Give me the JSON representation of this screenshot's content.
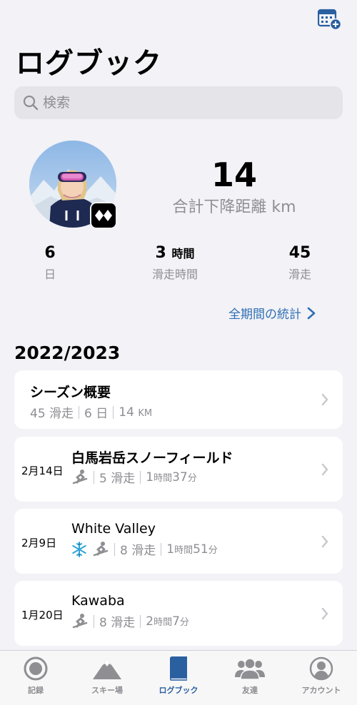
{
  "header": {
    "title": "ログブック"
  },
  "search": {
    "placeholder": "検索"
  },
  "summary": {
    "total_descent_value": "14",
    "total_descent_label": "合計下降距離 km",
    "stats": [
      {
        "value": "6",
        "unit": "",
        "label": "日"
      },
      {
        "value": "3",
        "unit": "時間",
        "label": "滑走時間"
      },
      {
        "value": "45",
        "unit": "",
        "label": "滑走"
      }
    ],
    "all_stats_link": "全期間の統計"
  },
  "season": {
    "title": "2022/2023",
    "overview": {
      "title": "シーズン概要",
      "runs": "45 滑走",
      "days": "6 日",
      "distance_value": "14",
      "distance_unit": "KM"
    }
  },
  "entries": [
    {
      "date": "2月14日",
      "name": "白馬岩岳スノーフィールド",
      "runs": "5 滑走",
      "duration_h": "1",
      "duration_h_unit": "時間",
      "duration_m": "37",
      "duration_m_unit": "分"
    },
    {
      "date": "2月9日",
      "name": "White Valley",
      "runs": "8 滑走",
      "duration_h": "1",
      "duration_h_unit": "時間",
      "duration_m": "51",
      "duration_m_unit": "分"
    },
    {
      "date": "1月20日",
      "name": "Kawaba",
      "runs": "8 滑走",
      "duration_h": "2",
      "duration_h_unit": "時間",
      "duration_m": "7",
      "duration_m_unit": "分"
    }
  ],
  "tabs": [
    {
      "label": "記録",
      "icon": "record-icon"
    },
    {
      "label": "スキー場",
      "icon": "mountain-icon"
    },
    {
      "label": "ログブック",
      "icon": "book-icon"
    },
    {
      "label": "友達",
      "icon": "friends-icon"
    },
    {
      "label": "アカウント",
      "icon": "account-icon"
    }
  ],
  "colors": {
    "accent": "#2a5fa0",
    "link": "#2f6fb3",
    "snowflake": "#2fa3d8",
    "background": "#f2f2f7"
  }
}
